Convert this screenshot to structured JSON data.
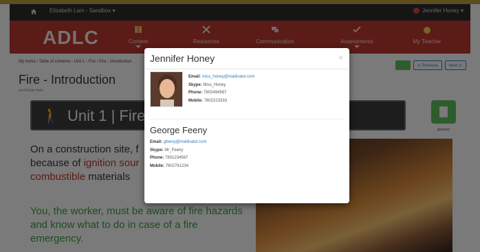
{
  "navbar": {
    "user_left": "Elizabeth Lam - Sandbox ▾",
    "user_right": "Jennifer Honey ▾"
  },
  "header": {
    "logo": "ADLC",
    "menu": [
      {
        "label": "Content",
        "icon": "book-icon"
      },
      {
        "label": "Resources",
        "icon": "tools-icon"
      },
      {
        "label": "Communication",
        "icon": "chat-icon"
      },
      {
        "label": "Assessments",
        "icon": "checklist-icon"
      },
      {
        "label": "My Teacher",
        "icon": "apple-icon"
      }
    ]
  },
  "breadcrumb": "My home › Table of contents › Unit 1 › Fire › Fire - Introduction",
  "page": {
    "title": "Fire - Introduction",
    "subtitle": "not Fire/air fuels",
    "previous_label": "⊙ Previous",
    "next_label": "Next ⊙",
    "unit_banner": "Unit 1 | Fire",
    "glossary_label": "glossary"
  },
  "body": {
    "para1_a": "On a construction site, f",
    "para1_b": "because of ",
    "para1_red1": "ignition sour",
    "para1_red2": "combustible",
    "para1_c": " materials",
    "para2": "You, the worker, must be aware of fire hazards and know what to do in case of a fire emergency."
  },
  "modal": {
    "title": "Jennifer Honey",
    "close": "×",
    "contact1": {
      "email_label": "Email:",
      "email": "miss_honey@mailinator.com",
      "skype_label": "Skype:",
      "skype": "Miss_Honey",
      "phone_label": "Phone:",
      "phone": "7802494567",
      "mobile_label": "Mobile:",
      "mobile": "7802223333"
    },
    "contact2": {
      "name": "George Feeny",
      "email_label": "Email:",
      "email": "gfeeny@mailinator.com",
      "skype_label": "Skype:",
      "skype": "Mr_Feeny",
      "phone_label": "Phone:",
      "phone": "7801234567",
      "mobile_label": "Mobile:",
      "mobile": "7802761234"
    }
  }
}
